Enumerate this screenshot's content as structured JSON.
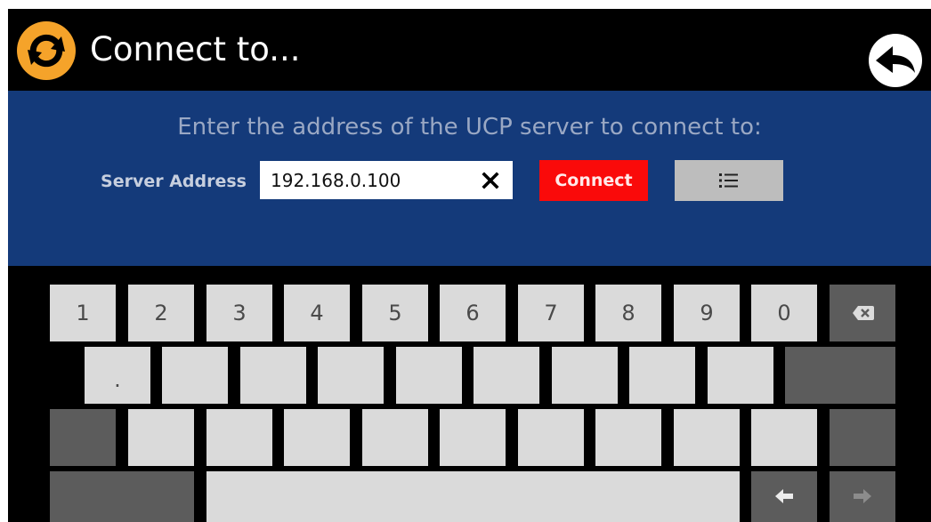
{
  "header": {
    "title": "Connect to...",
    "sync_icon": "sync-icon",
    "back_icon": "back-arrow-icon"
  },
  "panel": {
    "prompt": "Enter the address of the UCP server to connect to:",
    "address_label": "Server Address",
    "address_value": "192.168.0.100",
    "clear_icon": "close-icon",
    "connect_label": "Connect",
    "list_icon": "list-icon"
  },
  "keyboard": {
    "row1": [
      "1",
      "2",
      "3",
      "4",
      "5",
      "6",
      "7",
      "8",
      "9",
      "0"
    ],
    "row2": [
      ".",
      "",
      "",
      "",
      "",
      "",
      "",
      "",
      ""
    ],
    "row3": [
      "",
      "",
      "",
      "",
      "",
      "",
      "",
      "",
      "",
      ""
    ],
    "backspace_icon": "backspace-icon",
    "left_icon": "arrow-left-icon",
    "right_icon": "arrow-right-icon"
  },
  "colors": {
    "header_bg": "#000000",
    "panel_bg": "#143a7a",
    "accent_orange": "#f5a32a",
    "connect_red": "#fa0a0a",
    "key_light": "#dadada",
    "key_dark": "#5c5c5c"
  }
}
